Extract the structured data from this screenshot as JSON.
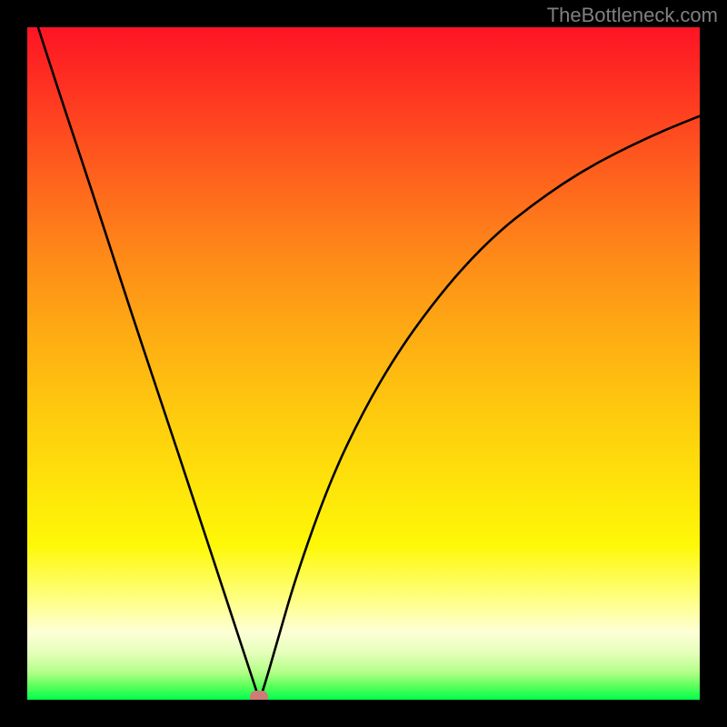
{
  "watermark": "TheBottleneck.com",
  "chart_data": {
    "type": "line",
    "title": "",
    "xlabel": "",
    "ylabel": "",
    "xlim": [
      0,
      1
    ],
    "ylim": [
      0,
      1
    ],
    "x": [
      0.0,
      0.05,
      0.1,
      0.15,
      0.2,
      0.25,
      0.3,
      0.34,
      0.345,
      0.35,
      0.37,
      0.4,
      0.45,
      0.5,
      0.55,
      0.6,
      0.65,
      0.7,
      0.75,
      0.8,
      0.85,
      0.9,
      0.95,
      1.0
    ],
    "values": [
      1.05,
      0.895,
      0.745,
      0.59,
      0.44,
      0.29,
      0.137,
      0.016,
      0.0,
      0.012,
      0.08,
      0.185,
      0.325,
      0.43,
      0.515,
      0.585,
      0.645,
      0.695,
      0.735,
      0.77,
      0.8,
      0.825,
      0.848,
      0.868
    ],
    "notch": {
      "x": 0.345,
      "y": 0.0
    },
    "gradient_stops": [
      {
        "pos": 0.0,
        "color": "#fe1424"
      },
      {
        "pos": 0.5,
        "color": "#fec012"
      },
      {
        "pos": 0.8,
        "color": "#feff58"
      },
      {
        "pos": 0.93,
        "color": "#e5ffba"
      },
      {
        "pos": 1.0,
        "color": "#00ff4e"
      }
    ]
  }
}
